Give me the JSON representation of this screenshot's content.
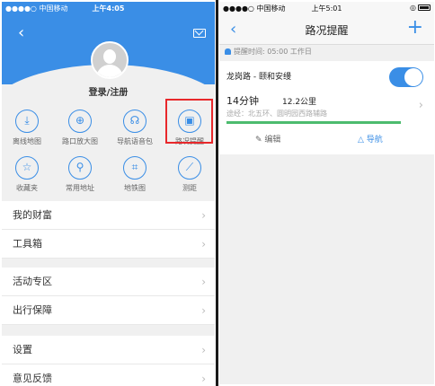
{
  "left": {
    "status": {
      "carrier": "●●●●○ 中国移动 ",
      "time": "上午4:05",
      "right": "◎ ↗"
    },
    "login_label": "登录/注册",
    "grid": [
      {
        "label": "离线地图",
        "icon": "download-icon"
      },
      {
        "label": "路口放大图",
        "icon": "zoom-icon"
      },
      {
        "label": "导航语音包",
        "icon": "voice-icon"
      },
      {
        "label": "路况提醒",
        "icon": "traffic-alert-icon"
      },
      {
        "label": "收藏夹",
        "icon": "star-icon"
      },
      {
        "label": "常用地址",
        "icon": "pin-icon"
      },
      {
        "label": "地铁图",
        "icon": "subway-icon"
      },
      {
        "label": "测距",
        "icon": "ruler-icon"
      }
    ],
    "menu1": [
      "我的财富",
      "工具箱"
    ],
    "menu2": [
      "活动专区",
      "出行保障"
    ],
    "menu3": [
      "设置",
      "意见反馈"
    ]
  },
  "right": {
    "status": {
      "carrier": "●●●●○ 中国移动 ",
      "time": "上午5:01",
      "right": "◎"
    },
    "title": "路况提醒",
    "remind_time": "提醒时间: 05:00 工作日",
    "route": "龙岗路 - 颐和安缦",
    "minutes": "14分钟",
    "distance": "12.2公里",
    "via": "途经：北五环、圆明园西路辅路",
    "edit_label": "✎ 编辑",
    "nav_label": "△ 导航",
    "colors": {
      "accent": "#3a8ee6",
      "traffic_green": "#4cbb6e",
      "highlight_red": "#e8282b"
    }
  }
}
